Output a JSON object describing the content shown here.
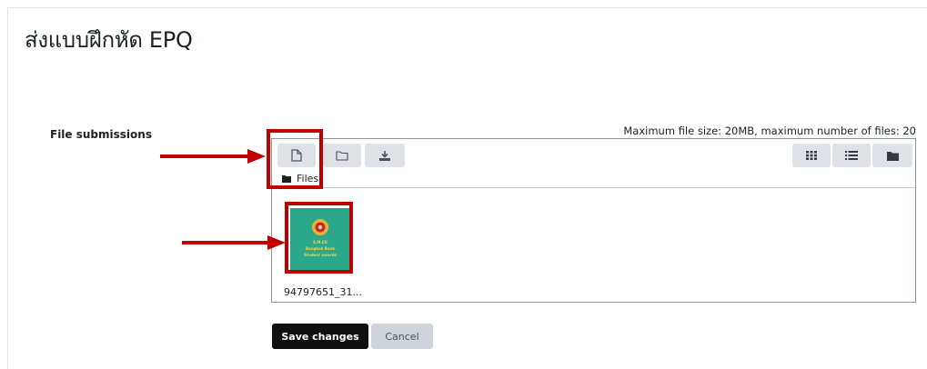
{
  "page": {
    "title": "ส่งแบบฝึกหัด EPQ"
  },
  "submission": {
    "label": "File submissions",
    "limits": "Maximum file size: 20MB, maximum number of files: 20"
  },
  "filemanager": {
    "toolbar_left": [
      {
        "name": "add-file",
        "icon": "file-icon"
      },
      {
        "name": "create-folder",
        "icon": "folder-icon"
      },
      {
        "name": "download",
        "icon": "download-icon"
      }
    ],
    "toolbar_right": [
      {
        "name": "icon-view",
        "icon": "grid-icon"
      },
      {
        "name": "list-view",
        "icon": "list-icon"
      },
      {
        "name": "tree-view",
        "icon": "folder-solid-icon"
      }
    ],
    "breadcrumb": "Files",
    "files": [
      {
        "name": "94797651_31..."
      }
    ]
  },
  "thumbnail": {
    "badge": "S.M.ED",
    "line1": "Bangkok Bank",
    "line2": "Student awards"
  },
  "buttons": {
    "save": "Save changes",
    "cancel": "Cancel"
  },
  "annotations": {
    "color": "#c00000"
  }
}
